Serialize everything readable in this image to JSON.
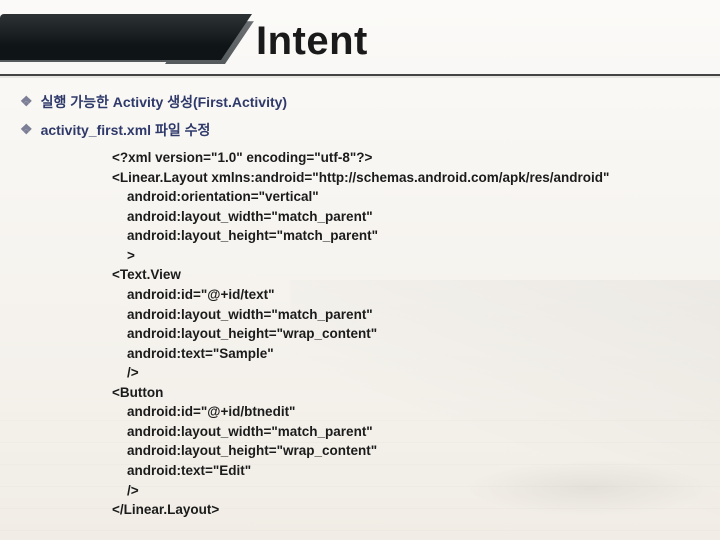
{
  "title": "Intent",
  "bullets": [
    "실행 가능한 Activity 생성(First.Activity)",
    "activity_first.xml 파일 수정"
  ],
  "code": "<?xml version=\"1.0\" encoding=\"utf-8\"?>\n<Linear.Layout xmlns:android=\"http://schemas.android.com/apk/res/android\"\n    android:orientation=\"vertical\"\n    android:layout_width=\"match_parent\"\n    android:layout_height=\"match_parent\"\n    >\n<Text.View\n    android:id=\"@+id/text\"\n    android:layout_width=\"match_parent\"\n    android:layout_height=\"wrap_content\"\n    android:text=\"Sample\"\n    />\n<Button\n    android:id=\"@+id/btnedit\"\n    android:layout_width=\"match_parent\"\n    android:layout_height=\"wrap_content\"\n    android:text=\"Edit\"\n    />\n</Linear.Layout>"
}
